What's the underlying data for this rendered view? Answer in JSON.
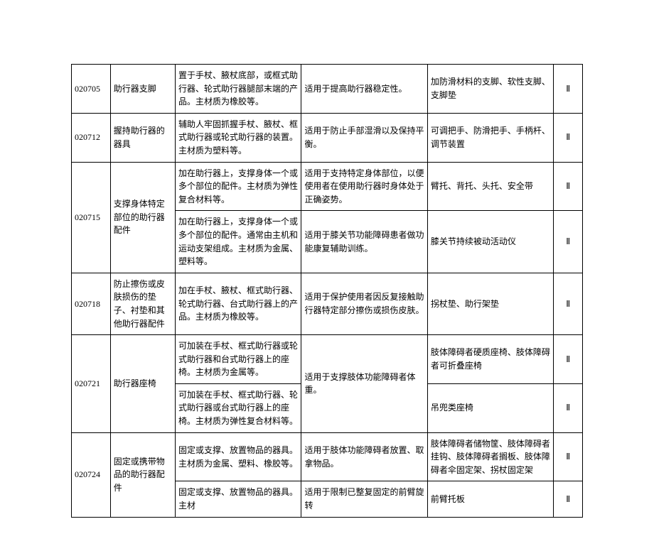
{
  "rows": [
    {
      "code": "020705",
      "name": "助行器支脚",
      "desc": "置于手杖、腋杖底部，或框式助行器、轮式助行器腿部末端的产品。主材质为橡胶等。",
      "use": "适用于提高助行器稳定性。",
      "example": "加防滑材料的支脚、软性支脚、支脚垫",
      "class": "Ⅱ"
    },
    {
      "code": "020712",
      "name": "握持助行器的器具",
      "desc": "辅助人牢固抓握手杖、腋杖、框式助行器或轮式助行器的装置。主材质为塑料等。",
      "use": "适用于防止手部湿滑以及保持平衡。",
      "example": "可调把手、防滑把手、手柄杆、调节装置",
      "class": "Ⅱ"
    },
    {
      "code": "020715",
      "name": "支撑身体特定部位的助行器配件",
      "subrows": [
        {
          "desc": "加在助行器上，支撑身体一个或多个部位的配件。主材质为弹性复合材料等。",
          "use": "适用于支持特定身体部位，以便使用者在使用助行器时身体处于正确姿势。",
          "example": "臂托、背托、头托、安全带",
          "class": "Ⅱ"
        },
        {
          "desc": "加在助行器上，支撑身体一个或多个部位的配件。通常由主机和运动支架组成。主材质为金属、塑料等。",
          "use": "适用于膝关节功能障碍患者做功能康复辅助训练。",
          "example": "膝关节持续被动活动仪",
          "class": "Ⅱ"
        }
      ]
    },
    {
      "code": "020718",
      "name": "防止擦伤或皮肤损伤的垫子、衬垫和其他助行器配件",
      "desc": "加在手杖、腋杖、框式助行器、轮式助行器、台式助行器上的产品。主材质为橡胶等。",
      "use": "适用于保护使用者因反复接触助行器特定部分擦伤或损伤皮肤。",
      "example": "拐杖垫、助行架垫",
      "class": "Ⅱ"
    },
    {
      "code": "020721",
      "name": "助行器座椅",
      "useMerged": "适用于支撑肢体功能障碍者体重。",
      "subrows": [
        {
          "desc": "可加装在手杖、框式助行器或轮式助行器和台式助行器上的座椅。主材质为金属等。",
          "example": "肢体障碍者硬质座椅、肢体障碍者可折叠座椅",
          "class": "Ⅱ"
        },
        {
          "desc": "可加装在手杖、框式助行器、轮式助行器或台式助行器上的座椅。主材质为弹性复合材料等。",
          "example": "吊兜类座椅",
          "class": "Ⅱ"
        }
      ]
    },
    {
      "code": "020724",
      "name": "固定或携带物品的助行器配件",
      "subrows": [
        {
          "desc": "固定或支撑、放置物品的器具。主材质为金属、塑料、橡胶等。",
          "use": "适用于肢体功能障碍者放置、取拿物品。",
          "example": "肢体障碍者储物筐、肢体障碍者挂钩、肢体障碍者搁板、肢体障碍者伞固定架、拐杖固定架",
          "class": "Ⅱ"
        },
        {
          "desc": "固定或支撑、放置物品的器具。主材",
          "use": "适用于限制已整复固定的前臂旋转",
          "example": "前臂托板",
          "class": "Ⅱ"
        }
      ]
    }
  ]
}
